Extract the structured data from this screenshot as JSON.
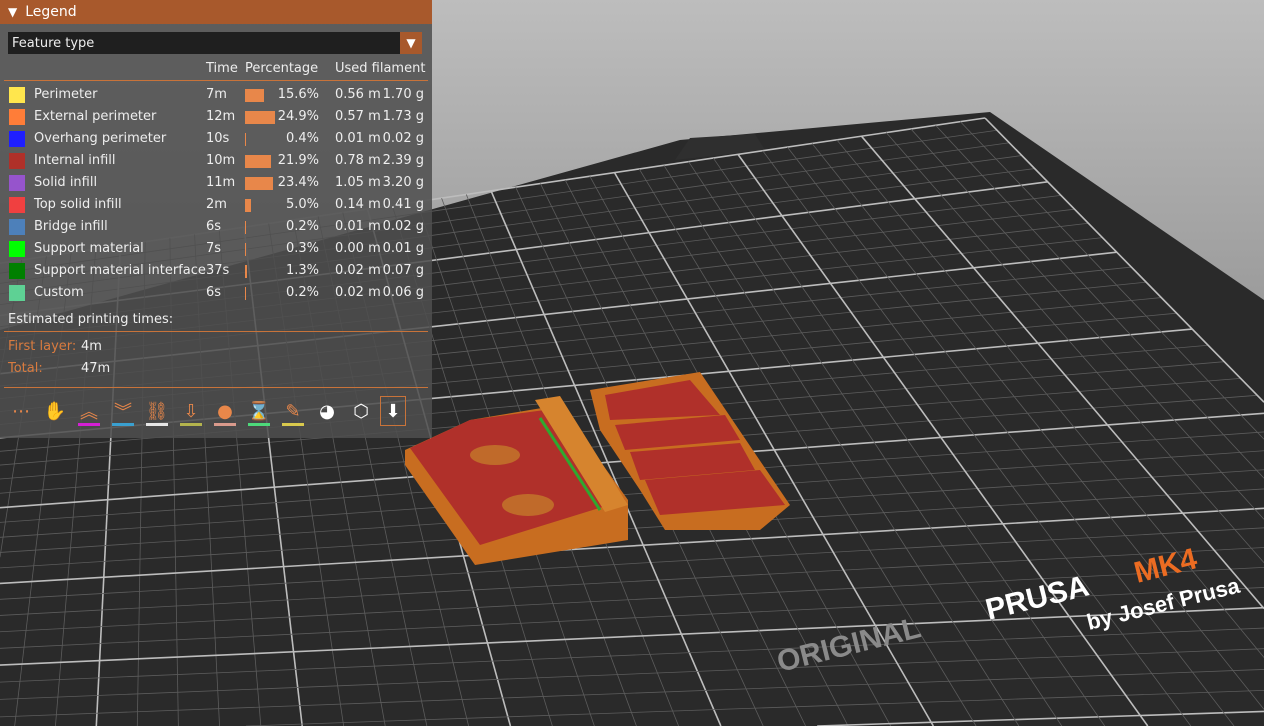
{
  "legend": {
    "title": "Legend",
    "view_type": "Feature type",
    "columns": {
      "time": "Time",
      "percentage": "Percentage",
      "used_filament": "Used filament"
    },
    "rows": [
      {
        "label": "Perimeter",
        "color": "#ffe64d",
        "time": "7m",
        "percent": 15.6,
        "percent_label": "15.6%",
        "meters": "0.56 m",
        "grams": "1.70 g"
      },
      {
        "label": "External perimeter",
        "color": "#ff7d38",
        "time": "12m",
        "percent": 24.9,
        "percent_label": "24.9%",
        "meters": "0.57 m",
        "grams": "1.73 g"
      },
      {
        "label": "Overhang perimeter",
        "color": "#1f1fff",
        "time": "10s",
        "percent": 0.4,
        "percent_label": "0.4%",
        "meters": "0.01 m",
        "grams": "0.02 g"
      },
      {
        "label": "Internal infill",
        "color": "#b03029",
        "time": "10m",
        "percent": 21.9,
        "percent_label": "21.9%",
        "meters": "0.78 m",
        "grams": "2.39 g"
      },
      {
        "label": "Solid infill",
        "color": "#9654cc",
        "time": "11m",
        "percent": 23.4,
        "percent_label": "23.4%",
        "meters": "1.05 m",
        "grams": "3.20 g"
      },
      {
        "label": "Top solid infill",
        "color": "#f04040",
        "time": "2m",
        "percent": 5.0,
        "percent_label": "5.0%",
        "meters": "0.14 m",
        "grams": "0.41 g"
      },
      {
        "label": "Bridge infill",
        "color": "#4d80ba",
        "time": "6s",
        "percent": 0.2,
        "percent_label": "0.2%",
        "meters": "0.01 m",
        "grams": "0.02 g"
      },
      {
        "label": "Support material",
        "color": "#00ff00",
        "time": "7s",
        "percent": 0.3,
        "percent_label": "0.3%",
        "meters": "0.00 m",
        "grams": "0.01 g"
      },
      {
        "label": "Support material interface",
        "color": "#008000",
        "time": "37s",
        "percent": 1.3,
        "percent_label": "1.3%",
        "meters": "0.02 m",
        "grams": "0.07 g"
      },
      {
        "label": "Custom",
        "color": "#5ed194",
        "time": "6s",
        "percent": 0.2,
        "percent_label": "0.2%",
        "meters": "0.02 m",
        "grams": "0.06 g"
      }
    ],
    "estimated_title": "Estimated printing times:",
    "first_layer_label": "First layer:",
    "first_layer_value": "4m",
    "total_label": "Total:",
    "total_value": "47m"
  },
  "toolbar": [
    {
      "name": "travel-icon",
      "glyph": "⋯",
      "underline": ""
    },
    {
      "name": "wipe-icon",
      "glyph": "✋",
      "underline": ""
    },
    {
      "name": "retractions-icon",
      "glyph": "︽",
      "underline": "#d41fd4"
    },
    {
      "name": "deretractions-icon",
      "glyph": "︾",
      "underline": "#3aa0d0"
    },
    {
      "name": "seams-icon",
      "glyph": "⛓",
      "underline": "#e6e6e6"
    },
    {
      "name": "tool-changes-icon",
      "glyph": "⇩",
      "underline": "#b3b34d"
    },
    {
      "name": "color-changes-icon",
      "glyph": "●",
      "underline": "#d99a8c"
    },
    {
      "name": "pause-prints-icon",
      "glyph": "⌛",
      "underline": "#4dd97a"
    },
    {
      "name": "custom-gcodes-icon",
      "glyph": "✎",
      "underline": "#d9c94d"
    },
    {
      "name": "center-of-gravity-icon",
      "glyph": "◕",
      "underline": ""
    },
    {
      "name": "shells-icon",
      "glyph": "⬡",
      "underline": ""
    },
    {
      "name": "tool-marker-icon",
      "glyph": "⬇",
      "underline": ""
    }
  ],
  "bed": {
    "brand_a": "ORIGINAL",
    "brand_b": "PRUSA",
    "brand_c": "MK4",
    "brand_d": "by Josef Prusa"
  }
}
